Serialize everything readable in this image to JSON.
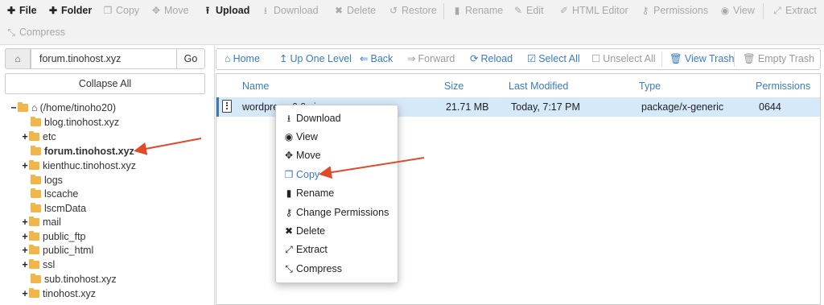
{
  "toolbar": {
    "items": [
      {
        "label": "File",
        "icon": "plus-icon",
        "state": "active"
      },
      {
        "label": "Folder",
        "icon": "plus-icon",
        "state": "active"
      },
      {
        "label": "Copy",
        "icon": "copy-icon",
        "state": "disabled"
      },
      {
        "label": "Move",
        "icon": "move-icon",
        "state": "disabled"
      },
      {
        "label": "Upload",
        "icon": "upload-icon",
        "state": "active"
      },
      {
        "label": "Download",
        "icon": "download-icon",
        "state": "disabled"
      },
      {
        "label": "Delete",
        "icon": "close-icon",
        "state": "disabled"
      },
      {
        "label": "Restore",
        "icon": "undo-icon",
        "state": "disabled"
      },
      {
        "label": "Rename",
        "icon": "file-icon",
        "state": "disabled"
      },
      {
        "label": "Edit",
        "icon": "pencil-icon",
        "state": "disabled"
      },
      {
        "label": "HTML Editor",
        "icon": "edit-icon",
        "state": "disabled"
      },
      {
        "label": "Permissions",
        "icon": "key-icon",
        "state": "disabled"
      },
      {
        "label": "View",
        "icon": "eye-icon",
        "state": "disabled"
      },
      {
        "label": "Extract",
        "icon": "expand-icon",
        "state": "disabled"
      },
      {
        "label": "Compress",
        "icon": "compress-icon",
        "state": "disabled"
      }
    ]
  },
  "sidebar": {
    "path_value": "forum.tinohost.xyz",
    "go_label": "Go",
    "collapse_label": "Collapse All",
    "tree": [
      {
        "label": "(/home/tinoho20)",
        "expander": "−",
        "home": true
      },
      {
        "label": "blog.tinohost.xyz",
        "expander": ""
      },
      {
        "label": "etc",
        "expander": "+"
      },
      {
        "label": "forum.tinohost.xyz",
        "expander": "",
        "selected": true
      },
      {
        "label": "kienthuc.tinohost.xyz",
        "expander": "+"
      },
      {
        "label": "logs",
        "expander": ""
      },
      {
        "label": "lscache",
        "expander": ""
      },
      {
        "label": "lscmData",
        "expander": ""
      },
      {
        "label": "mail",
        "expander": "+"
      },
      {
        "label": "public_ftp",
        "expander": "+"
      },
      {
        "label": "public_html",
        "expander": "+"
      },
      {
        "label": "ssl",
        "expander": "+"
      },
      {
        "label": "sub.tinohost.xyz",
        "expander": ""
      },
      {
        "label": "tinohost.xyz",
        "expander": "+"
      }
    ]
  },
  "actionbar": {
    "items": [
      {
        "label": "Home",
        "icon": "home-icon",
        "state": "enabled"
      },
      {
        "label": "Up One Level",
        "icon": "level-up-icon",
        "state": "enabled"
      },
      {
        "label": "Back",
        "icon": "arrow-left-icon",
        "state": "enabled"
      },
      {
        "label": "Forward",
        "icon": "arrow-right-icon",
        "state": "disabled"
      },
      {
        "label": "Reload",
        "icon": "refresh-icon",
        "state": "enabled"
      },
      {
        "label": "Select All",
        "icon": "checkbox-checked-icon",
        "state": "enabled"
      },
      {
        "label": "Unselect All",
        "icon": "checkbox-empty-icon",
        "state": "disabled"
      },
      {
        "label": "View Trash",
        "icon": "trash-icon",
        "state": "enabled"
      },
      {
        "label": "Empty Trash",
        "icon": "trash-icon",
        "state": "disabled"
      }
    ]
  },
  "table": {
    "headers": {
      "name": "Name",
      "size": "Size",
      "modified": "Last Modified",
      "type": "Type",
      "permissions": "Permissions"
    },
    "rows": [
      {
        "name": "wordpress-6.0.zip",
        "size": "21.71 MB",
        "modified": "Today, 7:17 PM",
        "type": "package/x-generic",
        "permissions": "0644"
      }
    ]
  },
  "context_menu": {
    "items": [
      {
        "label": "Download",
        "icon": "download-icon"
      },
      {
        "label": "View",
        "icon": "eye-icon"
      },
      {
        "label": "Move",
        "icon": "move-icon"
      },
      {
        "label": "Copy",
        "icon": "copy-icon",
        "highlight": true
      },
      {
        "label": "Rename",
        "icon": "file-icon"
      },
      {
        "label": "Change Permissions",
        "icon": "key-icon"
      },
      {
        "label": "Delete",
        "icon": "close-icon"
      },
      {
        "label": "Extract",
        "icon": "expand-icon"
      },
      {
        "label": "Compress",
        "icon": "compress-icon"
      }
    ]
  },
  "colors": {
    "link": "#3a7bbf",
    "selected_row": "#d6e9f8",
    "annotation_arrow": "#e04a2b",
    "folder": "#f0b64a"
  }
}
